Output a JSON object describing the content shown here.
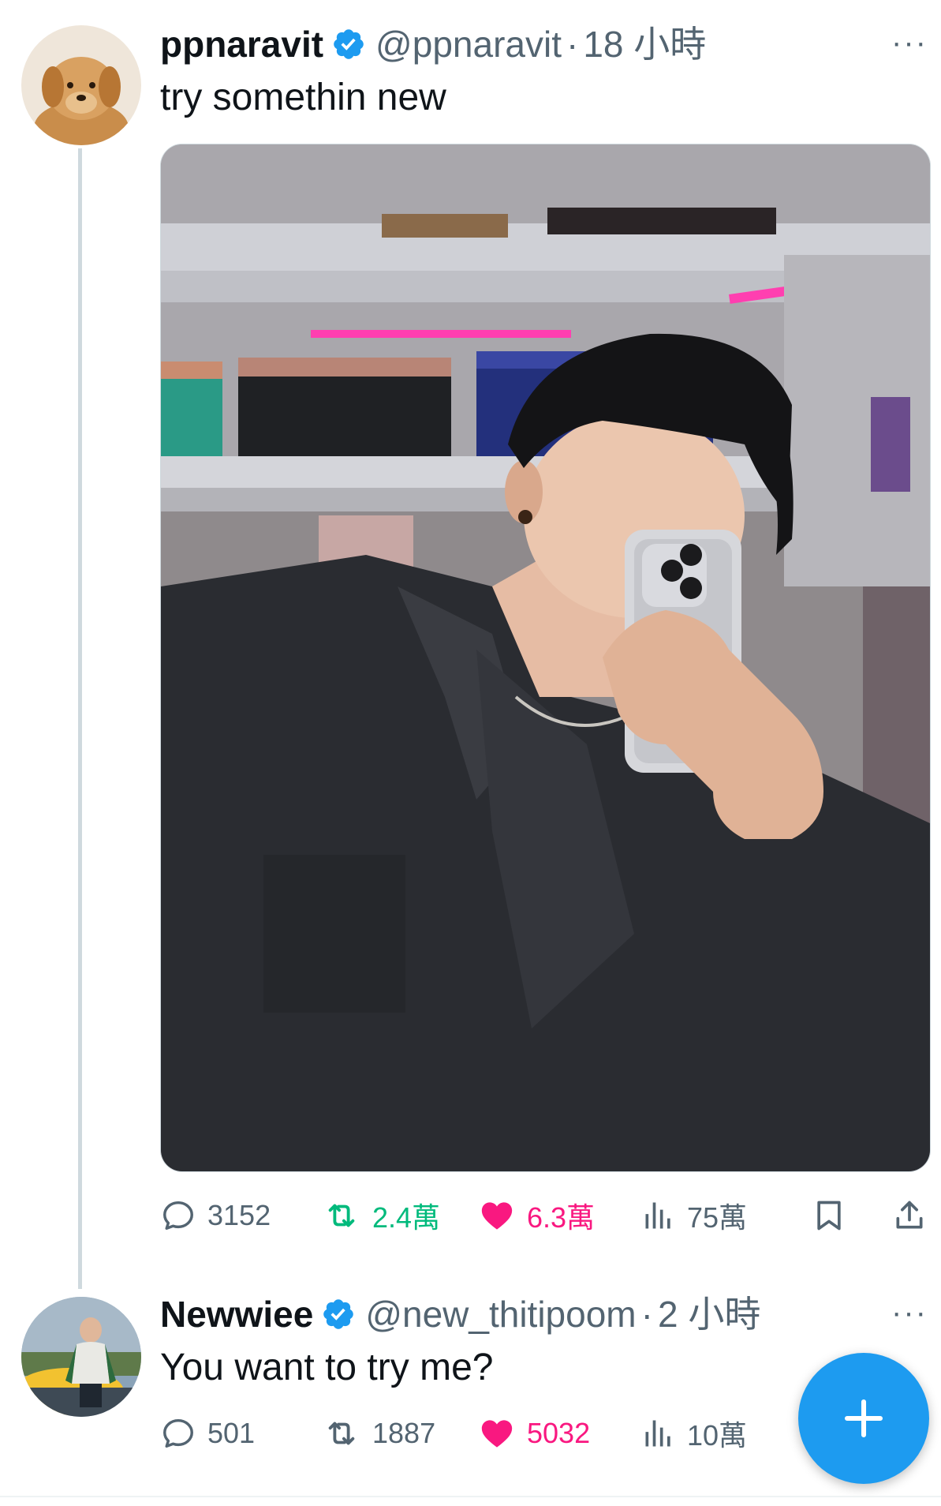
{
  "tweets": [
    {
      "display_name": "ppnaravit",
      "handle": "@ppnaravit",
      "separator": "·",
      "time": "18 小時",
      "text": "try somethin new",
      "more": "···",
      "stats": {
        "replies": "3152",
        "retweets": "2.4萬",
        "likes": "6.3萬",
        "views": "75萬"
      }
    },
    {
      "display_name": "Newwiee",
      "handle": "@new_thitipoom",
      "separator": "·",
      "time": "2 小時",
      "text": "You want to try me?",
      "more": "···",
      "stats": {
        "replies": "501",
        "retweets": "1887",
        "likes": "5032",
        "views": "10萬"
      }
    }
  ],
  "colors": {
    "accent": "#1d9bf0",
    "retweet": "#00ba7c",
    "like": "#f91880",
    "secondary_text": "#536471",
    "thread_line": "#cfd9de"
  },
  "icons": {
    "reply": "reply-icon",
    "retweet": "retweet-icon",
    "like": "heart-icon",
    "views": "views-bar-chart-icon",
    "bookmark": "bookmark-icon",
    "share": "share-icon",
    "verified": "verified-badge-icon",
    "compose": "plus-icon"
  }
}
